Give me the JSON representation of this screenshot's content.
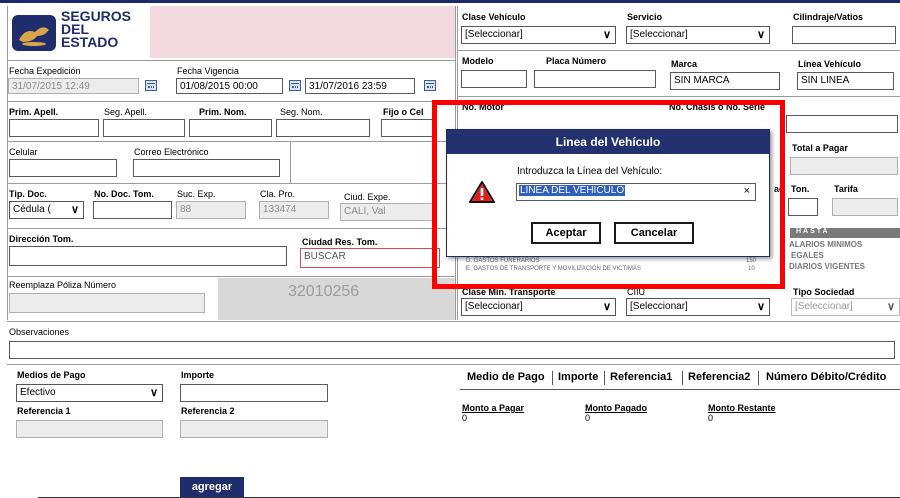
{
  "brand": {
    "line1": "SEGUROS",
    "line2": "DEL",
    "line3": "ESTADO"
  },
  "expedicion": {
    "label": "Fecha Expedición",
    "value": "31/07/2015 12:49"
  },
  "vigencia": {
    "label": "Fecha Vigencia",
    "from": "01/08/2015 00:00",
    "to": "31/07/2016 23:59"
  },
  "tomador": {
    "prim_apell": "Prim. Apell.",
    "seg_apell": "Seg. Apell.",
    "prim_nom": "Prim. Nom.",
    "seg_nom": "Seg. Nom.",
    "fijo": "Fijo o Cel",
    "celular": "Celular",
    "correo": "Correo Electrónico",
    "tip_doc": "Tip. Doc.",
    "tip_doc_value": "Cédula (",
    "no_doc": "No. Doc. Tom.",
    "suc_exp": "Suc. Exp.",
    "suc_exp_value": "88",
    "cla_pro": "Cla. Pro.",
    "cla_pro_value": "133474",
    "ciud_expe": "Ciud. Expe.",
    "ciud_expe_value": "CALI, Val",
    "direccion": "Dirección Tom.",
    "ciudad_res": "Ciudad Res. Tom.",
    "ciudad_res_value": "BUSCAR",
    "reemplaza": "Reemplaza Póliza Número",
    "poliza_number": "32010256"
  },
  "vehiculo": {
    "clase_label": "Clase Vehículo",
    "clase_value": "[Seleccionar]",
    "servicio_label": "Servicio",
    "servicio_value": "[Seleccionar]",
    "cilindraje_label": "Cilindraje/Vatios",
    "modelo_label": "Modelo",
    "placa_label": "Placa Número",
    "marca_label": "Marca",
    "marca_value": "SIN MARCA",
    "linea_label": "Línea Vehículo",
    "linea_value": "SIN LINEA",
    "motor_label": "No. Motor",
    "chasis_label": "No. Chasis o No. Serie",
    "total_label": "Total a Pagar",
    "ton_label": "Ton.",
    "tarifa_label": "Tarifa",
    "ac_label": "ac",
    "clase_min_label": "Clase Min. Transporte",
    "clase_min_value": "[Seleccionar]",
    "ciiu_label": "CIIU",
    "ciiu_value": "[Seleccionar]",
    "tipo_soc_label": "Tipo Sociedad",
    "tipo_soc_value": "[Seleccionar]"
  },
  "coverage": {
    "hasta": "HASTA",
    "row1": "ALARIOS MINIMOS",
    "row2": "EGALES",
    "row3": "DIARIOS VIGENTES",
    "gastos_fun": "D. GASTOS FUNERARIOS",
    "gastos_trans": "E. GASTOS DE TRANSPORTE Y MOVILIZACIÓN DE VICTIMAS",
    "val1": "150",
    "val2": "10"
  },
  "observaciones": {
    "label": "Observaciones"
  },
  "pago": {
    "medios_label": "Medios de Pago",
    "medios_value": "Efectivo",
    "importe_label": "Importe",
    "ref1_label": "Referencia 1",
    "ref2_label": "Referencia 2",
    "agregar": "agregar",
    "columns": [
      "Medio de Pago",
      "Importe",
      "Referencia1",
      "Referencia2",
      "Número Débito/Crédito"
    ],
    "monto_pagar_label": "Monto a Pagar",
    "monto_pagar": "0",
    "monto_pagado_label": "Monto Pagado",
    "monto_pagado": "0",
    "monto_restante_label": "Monto Restante",
    "monto_restante": "0"
  },
  "dialog": {
    "title": "Linea del Vehículo",
    "prompt": "Introduzca la Línea del Vehículo:",
    "value": "LINEA DEL VEHICULO",
    "clear": "×",
    "accept": "Aceptar",
    "cancel": "Cancelar"
  },
  "colors": {
    "navy": "#24316f",
    "highlight": "#ff0000",
    "pink": "#f2d8df"
  }
}
